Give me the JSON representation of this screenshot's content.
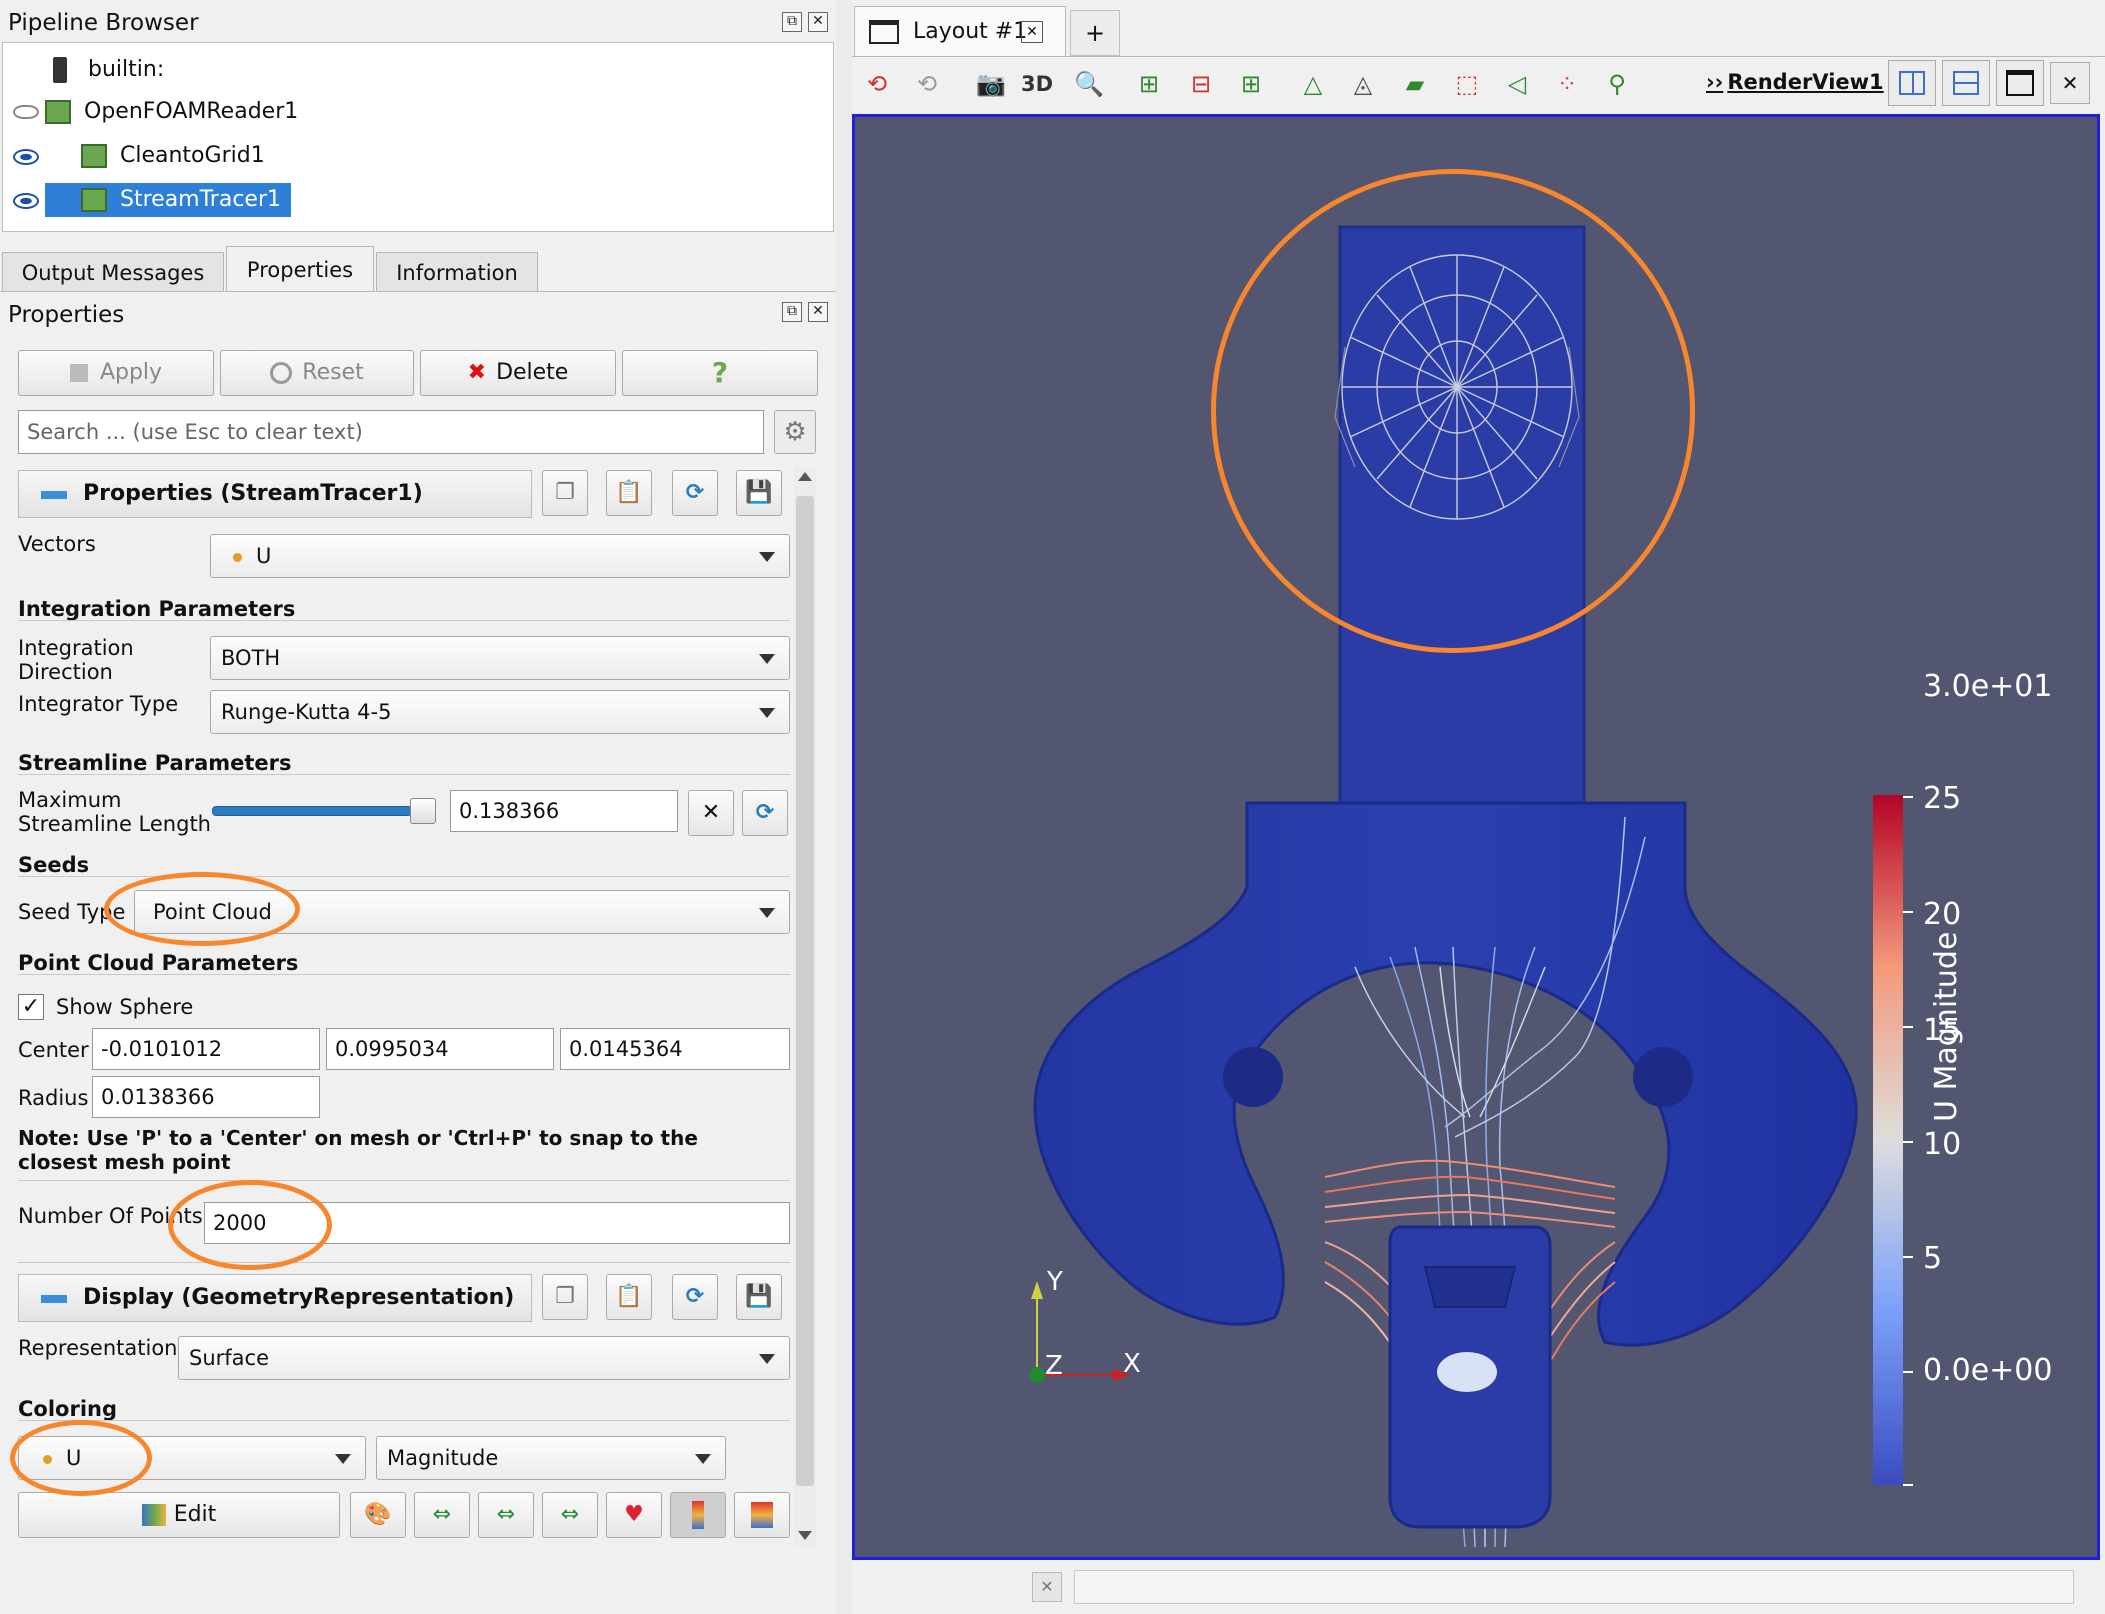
{
  "pipeline": {
    "title": "Pipeline Browser",
    "items": [
      {
        "label": "builtin:"
      },
      {
        "label": "OpenFOAMReader1"
      },
      {
        "label": "CleantoGrid1"
      },
      {
        "label": "StreamTracer1"
      }
    ]
  },
  "tabs": [
    "Output Messages",
    "Properties",
    "Information"
  ],
  "properties": {
    "title": "Properties",
    "apply": "Apply",
    "reset": "Reset",
    "delete": "Delete",
    "help": "?",
    "search_placeholder": "Search ... (use Esc to clear text)",
    "group1": "Properties (StreamTracer1)",
    "vectors_label": "Vectors",
    "vectors_value": "U",
    "integration_section": "Integration Parameters",
    "integration_direction_label": "Integration Direction",
    "integration_direction_value": "BOTH",
    "integrator_type_label": "Integrator Type",
    "integrator_type_value": "Runge-Kutta 4-5",
    "streamline_section": "Streamline Parameters",
    "max_length_label": "Maximum Streamline Length",
    "max_length_value": "0.138366",
    "seeds_section": "Seeds",
    "seed_type_label": "Seed Type",
    "seed_type_value": "Point Cloud",
    "point_cloud_section": "Point Cloud Parameters",
    "show_sphere_label": "Show Sphere",
    "show_sphere_checked": true,
    "center_label": "Center",
    "center_x": "-0.0101012",
    "center_y": "0.0995034",
    "center_z": "0.0145364",
    "radius_label": "Radius",
    "radius_value": "0.0138366",
    "note": "Note: Use 'P' to a 'Center' on mesh or 'Ctrl+P' to snap to the closest mesh point",
    "num_points_label": "Number Of Points",
    "num_points_value": "2000",
    "group2": "Display (GeometryRepresentation)",
    "representation_label": "Representation",
    "representation_value": "Surface",
    "coloring_section": "Coloring",
    "coloring_array": "U",
    "coloring_component": "Magnitude",
    "edit": "Edit"
  },
  "layout": {
    "tab_label": "Layout #1",
    "add_tab": "+",
    "mode_3d": "3D",
    "render_view": "RenderView1"
  },
  "colorbar": {
    "title": "U Magnitude",
    "ticks": [
      "3.0e+01",
      "25",
      "20",
      "15",
      "10",
      "5",
      "0.0e+00"
    ]
  },
  "axes": {
    "x": "X",
    "y": "Y",
    "z": "Z"
  },
  "colors": {
    "accent_orange": "#f7862c",
    "viewport_bg": "#525670",
    "geometry_blue": "#2b3fa6",
    "selection": "#2d7fd8"
  }
}
